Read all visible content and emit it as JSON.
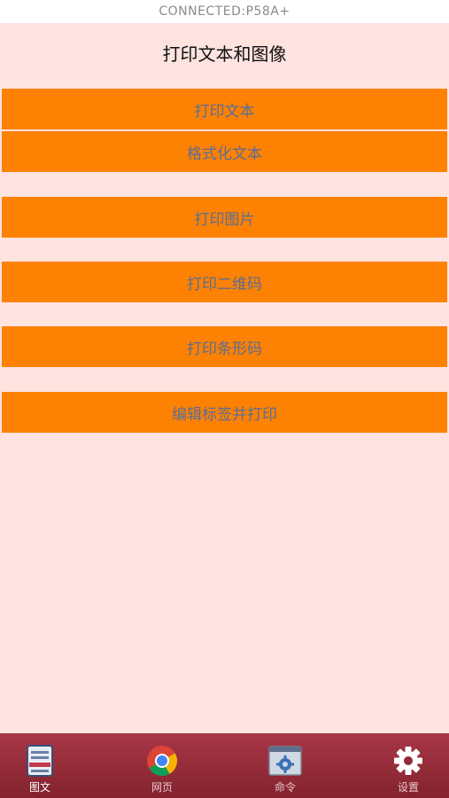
{
  "status": {
    "text": "CONNECTED:P58A+"
  },
  "page": {
    "title": "打印文本和图像"
  },
  "buttons": [
    {
      "label": "打印文本"
    },
    {
      "label": "格式化文本"
    },
    {
      "label": "打印图片"
    },
    {
      "label": "打印二维码"
    },
    {
      "label": "打印条形码"
    },
    {
      "label": "编辑标签并打印"
    }
  ],
  "tabbar": {
    "tabs": [
      {
        "label": "图文",
        "icon": "document-icon",
        "active": true
      },
      {
        "label": "网页",
        "icon": "chrome-icon",
        "active": false
      },
      {
        "label": "命令",
        "icon": "terminal-gear-icon",
        "active": false
      },
      {
        "label": "设置",
        "icon": "gear-icon",
        "active": false
      }
    ]
  },
  "colors": {
    "background": "#fee3df",
    "button": "#fd8102",
    "button_text": "#5a6e96",
    "tabbar": "#93293a"
  }
}
